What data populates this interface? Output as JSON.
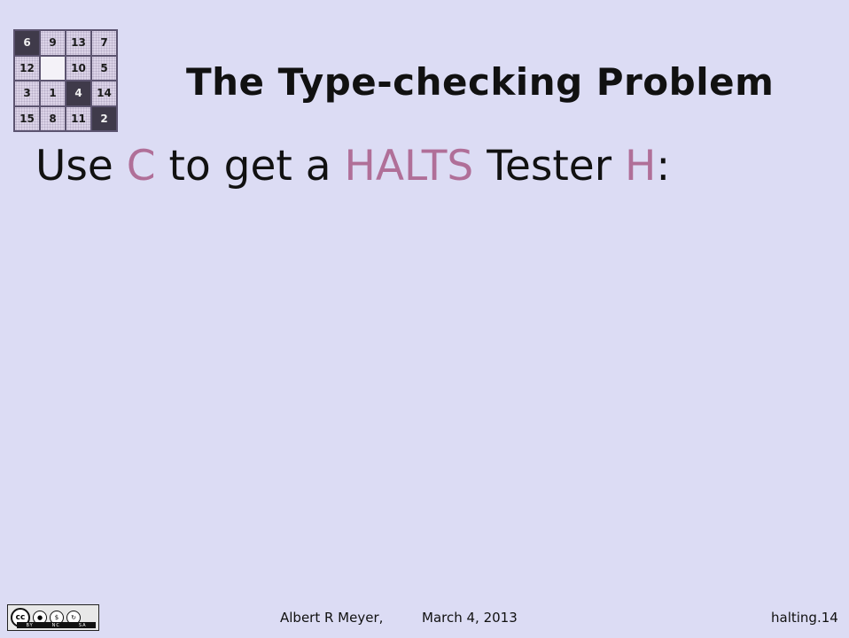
{
  "puzzle": {
    "tiles": [
      {
        "label": "6",
        "style": "dark"
      },
      {
        "label": "9",
        "style": "light"
      },
      {
        "label": "13",
        "style": "light"
      },
      {
        "label": "7",
        "style": "light"
      },
      {
        "label": "12",
        "style": "light"
      },
      {
        "label": "",
        "style": "blank"
      },
      {
        "label": "10",
        "style": "light"
      },
      {
        "label": "5",
        "style": "light"
      },
      {
        "label": "3",
        "style": "light"
      },
      {
        "label": "1",
        "style": "light"
      },
      {
        "label": "4",
        "style": "dark"
      },
      {
        "label": "14",
        "style": "light"
      },
      {
        "label": "15",
        "style": "light"
      },
      {
        "label": "8",
        "style": "light"
      },
      {
        "label": "11",
        "style": "light"
      },
      {
        "label": "2",
        "style": "dark"
      }
    ]
  },
  "slide": {
    "title": "The Type-checking Problem",
    "headline": {
      "w1": "Use ",
      "c": "C",
      "w2": " to get a ",
      "halts": "HALTS",
      "w3": " Tester ",
      "h": "H",
      "w4": ":"
    }
  },
  "footer": {
    "license_badge": {
      "cc": "cc",
      "icons": [
        "BY",
        "NC",
        "SA"
      ]
    },
    "author": "Albert R Meyer,",
    "date": "March 4, 2013",
    "slide_id": "halting.14"
  },
  "colors": {
    "background": "#dcdcf4",
    "highlight": "#b06f98",
    "text": "#111111"
  }
}
